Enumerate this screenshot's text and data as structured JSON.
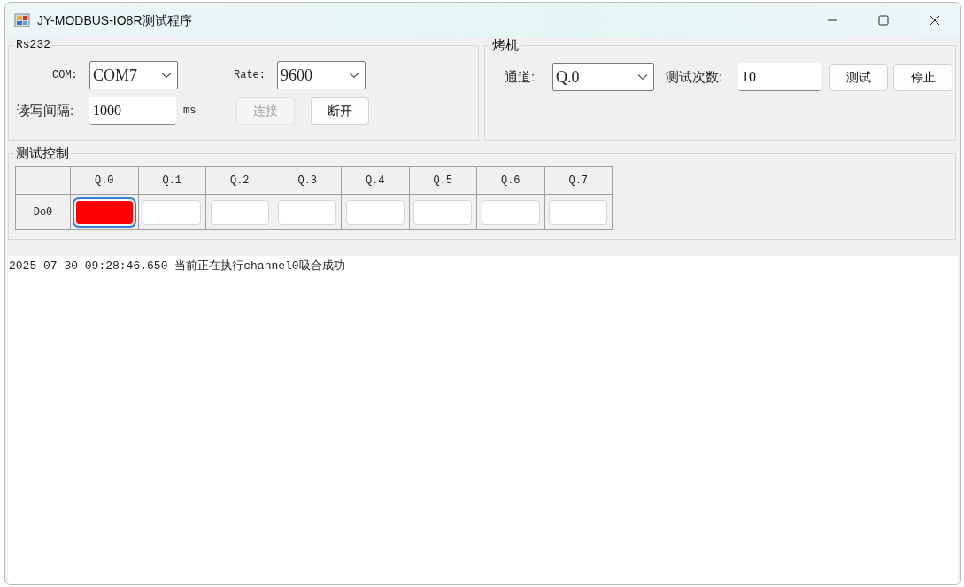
{
  "window": {
    "title": "JY-MODBUS-IO8R测试程序"
  },
  "rs232": {
    "legend": "Rs232",
    "com_label": "COM:",
    "com_value": "COM7",
    "rate_label": "Rate:",
    "rate_value": "9600",
    "interval_label": "读写间隔:",
    "interval_value": "1000",
    "unit": "ms",
    "buttons": [
      {
        "label": "连接",
        "disabled": true
      },
      {
        "label": "断开",
        "disabled": false
      }
    ]
  },
  "burn_in": {
    "legend": "烤机",
    "channel_label": "通道:",
    "channel_value": "Q.0",
    "count_label": "测试次数:",
    "count_value": "10",
    "buttons": [
      {
        "label": "测试",
        "disabled": false
      },
      {
        "label": "停止",
        "disabled": false
      }
    ]
  },
  "test_control": {
    "legend": "测试控制",
    "columns": [
      "Q.0",
      "Q.1",
      "Q.2",
      "Q.3",
      "Q.4",
      "Q.5",
      "Q.6",
      "Q.7"
    ],
    "rows": [
      {
        "label": "Do0",
        "cells": [
          {
            "on": true,
            "focused": true
          },
          {
            "on": false,
            "focused": false
          },
          {
            "on": false,
            "focused": false
          },
          {
            "on": false,
            "focused": false
          },
          {
            "on": false,
            "focused": false
          },
          {
            "on": false,
            "focused": false
          },
          {
            "on": false,
            "focused": false
          },
          {
            "on": false,
            "focused": false
          }
        ]
      }
    ]
  },
  "log": {
    "lines": [
      "2025-07-30 09:28:46.650 当前正在执行channel0吸合成功"
    ]
  }
}
